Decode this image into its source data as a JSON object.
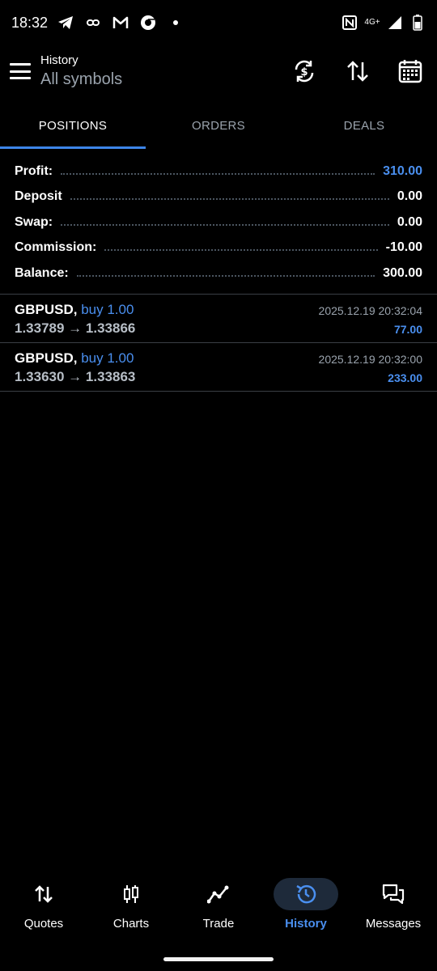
{
  "status_bar": {
    "time": "18:32",
    "left_icons": [
      "telegram-icon",
      "link-icon",
      "gmail-icon",
      "chrome-icon",
      "dot-icon"
    ],
    "right_icons": [
      "nfc-icon",
      "network-4g-icon",
      "signal-icon",
      "battery-icon"
    ],
    "network_label": "4G+"
  },
  "app_bar": {
    "title": "History",
    "subtitle": "All symbols",
    "actions": [
      "currency-exchange-icon",
      "sort-icon",
      "calendar-icon"
    ]
  },
  "tabs": [
    {
      "label": "POSITIONS",
      "active": true
    },
    {
      "label": "ORDERS",
      "active": false
    },
    {
      "label": "DEALS",
      "active": false
    }
  ],
  "summary": {
    "profit": {
      "label": "Profit:",
      "value": "310.00"
    },
    "deposit": {
      "label": "Deposit",
      "value": "0.00"
    },
    "swap": {
      "label": "Swap:",
      "value": "0.00"
    },
    "commission": {
      "label": "Commission:",
      "value": "-10.00"
    },
    "balance": {
      "label": "Balance:",
      "value": "300.00"
    }
  },
  "deals": [
    {
      "symbol": "GBPUSD,",
      "side": "buy 1.00",
      "prices": "1.33789 → 1.33866",
      "time": "2025.12.19 20:32:04",
      "profit": "77.00"
    },
    {
      "symbol": "GBPUSD,",
      "side": "buy 1.00",
      "prices": "1.33630 → 1.33863",
      "time": "2025.12.19 20:32:00",
      "profit": "233.00"
    }
  ],
  "bottom_nav": [
    {
      "label": "Quotes",
      "icon": "quotes-arrows-icon",
      "active": false
    },
    {
      "label": "Charts",
      "icon": "candlestick-icon",
      "active": false
    },
    {
      "label": "Trade",
      "icon": "trade-line-icon",
      "active": false
    },
    {
      "label": "History",
      "icon": "history-clock-icon",
      "active": true
    },
    {
      "label": "Messages",
      "icon": "messages-icon",
      "active": false
    }
  ],
  "colors": {
    "accent": "#3d85e8",
    "blue_text": "#4a8fef",
    "background": "#000000",
    "muted_text": "#9aa3ad"
  }
}
